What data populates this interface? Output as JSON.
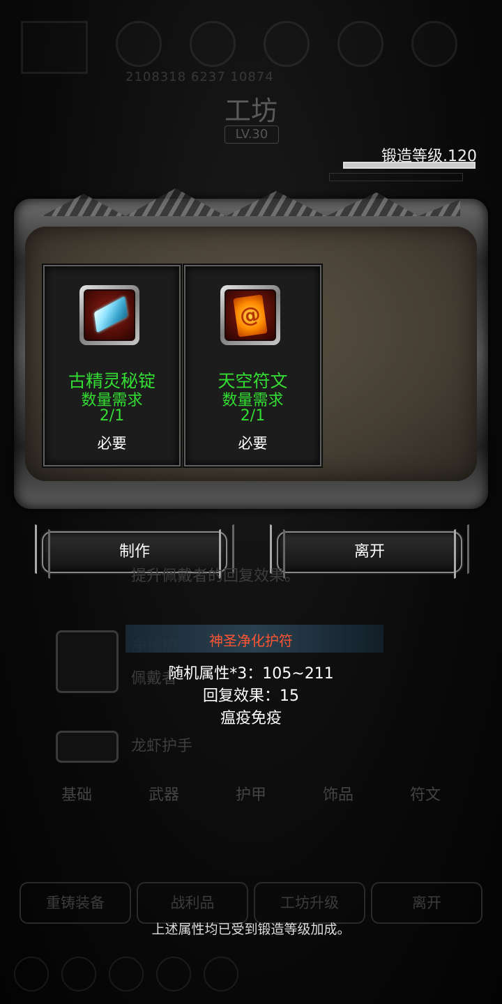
{
  "forge": {
    "level_text": "锻造等级.120",
    "progress": 1.0
  },
  "background": {
    "title": "工坊",
    "level_badge": "LV.30",
    "resources": "2108318  6237  10874",
    "list_desc_1": "提升佩戴者的回复效果。",
    "list_name_2": "净化护",
    "list_desc_2": "佩戴者",
    "list_name_3": "龙虾护手",
    "tabs": [
      "基础",
      "武器",
      "护甲",
      "饰品",
      "符文"
    ],
    "bottom_buttons": [
      "重铸装备",
      "战利品",
      "工坊升级",
      "离开"
    ]
  },
  "materials": [
    {
      "name": "古精灵秘锭",
      "req_label": "数量需求",
      "count": "2/1",
      "tag": "必要",
      "icon": "ancient-elf-ingot-icon"
    },
    {
      "name": "天空符文",
      "req_label": "数量需求",
      "count": "2/1",
      "tag": "必要",
      "icon": "sky-rune-icon"
    }
  ],
  "actions": {
    "make": "制作",
    "leave": "离开"
  },
  "tooltip": {
    "title": "神圣净化护符",
    "lines": [
      "随机属性*3：105~211",
      "回复效果：15",
      "瘟疫免疫"
    ]
  },
  "notice": "上述属性均已受到锻造等级加成。",
  "colors": {
    "item_green": "#33dd33",
    "tooltip_title": "#ff5533"
  }
}
